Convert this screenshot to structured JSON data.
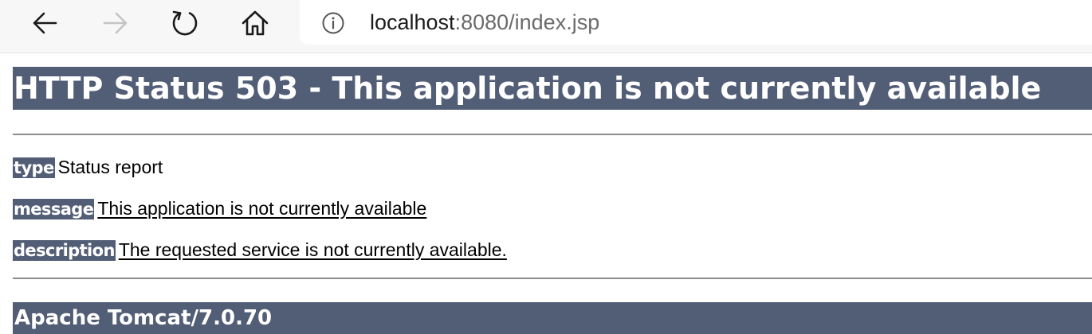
{
  "browser": {
    "url_host": "localhost",
    "url_rest": ":8080/index.jsp"
  },
  "page": {
    "title": "HTTP Status 503 - This application is not currently available",
    "rows": [
      {
        "label": "type",
        "value": "Status report"
      },
      {
        "label": "message",
        "value": "This application is not currently available"
      },
      {
        "label": "description",
        "value": "The requested service is not currently available."
      }
    ],
    "footer": "Apache Tomcat/7.0.70"
  },
  "colors": {
    "header_bg": "#525d76",
    "toolbar_bg": "#f7f7f7"
  },
  "icons": {
    "back": "arrow-left-icon",
    "forward": "arrow-right-icon",
    "reload": "reload-icon",
    "home": "home-icon",
    "info": "info-icon"
  }
}
